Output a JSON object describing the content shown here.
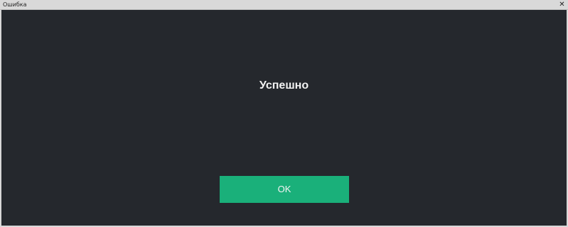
{
  "window": {
    "title": "Ошибка",
    "close_glyph": "✕"
  },
  "dialog": {
    "message": "Успешно",
    "ok_label": "OK"
  },
  "colors": {
    "background": "#25282d",
    "accent": "#1ab07a",
    "titlebar": "#d9d9d9"
  }
}
